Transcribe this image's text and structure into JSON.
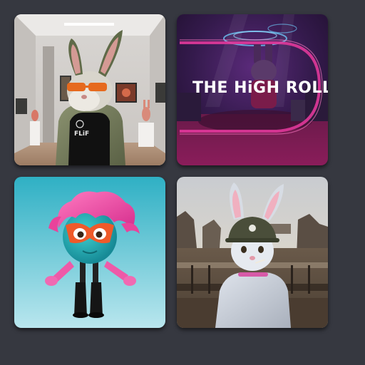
{
  "gallery": {
    "tiles": [
      {
        "id": "tile-1",
        "scene": "art-gallery",
        "character": "rabbit-black-tanktop-orange-glasses",
        "shirt_text": "FLiF"
      },
      {
        "id": "tile-2",
        "scene": "nightclub-stage",
        "character": "rabbit-dj",
        "banner_text": "THE HiGH ROLLA",
        "accent_color": "#d62f8e"
      },
      {
        "id": "tile-3",
        "scene": "cyan-studio",
        "character": "teal-ball-pink-hair-orange-mask",
        "accent_color": "#e9439b"
      },
      {
        "id": "tile-4",
        "scene": "war-trenches",
        "character": "rabbit-soldier-helmet"
      }
    ]
  }
}
